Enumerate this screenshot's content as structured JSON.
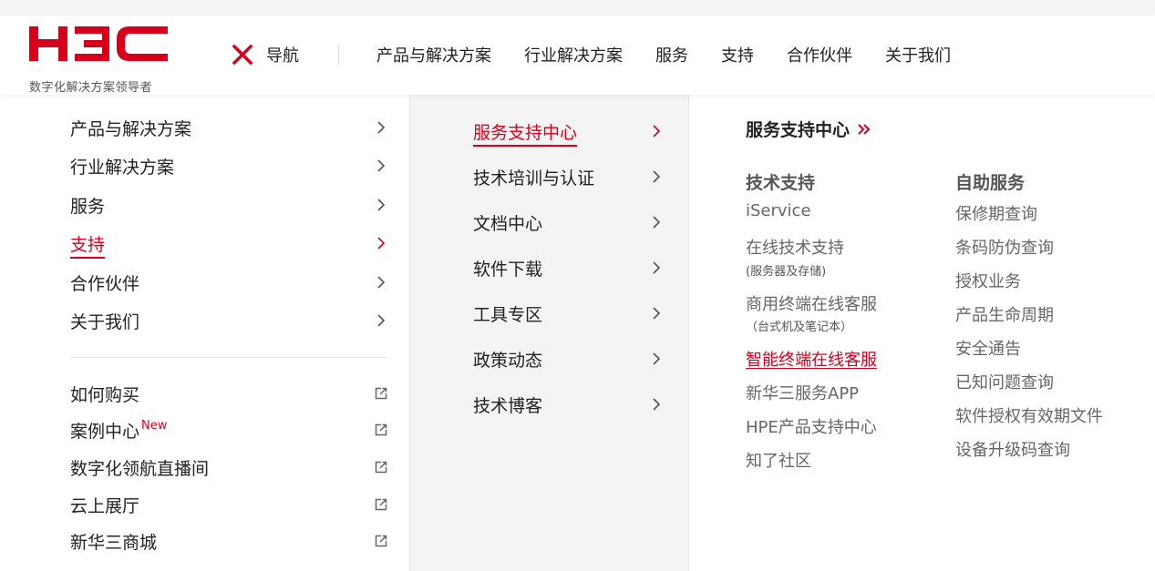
{
  "logo": {
    "wordmark": "H3C",
    "tagline": "数字化解决方案领导者",
    "brand_color": "#d6001c"
  },
  "header": {
    "nav_toggle_label": "导航",
    "close_icon": "close-x-icon",
    "nav_items": [
      "产品与解决方案",
      "行业解决方案",
      "服务",
      "支持",
      "合作伙伴",
      "关于我们"
    ]
  },
  "left_menu": {
    "items": [
      {
        "label": "产品与解决方案"
      },
      {
        "label": "行业解决方案"
      },
      {
        "label": "服务"
      },
      {
        "label": "支持",
        "active": true
      },
      {
        "label": "合作伙伴"
      },
      {
        "label": "关于我们"
      }
    ],
    "links": [
      {
        "label": "如何购买"
      },
      {
        "label": "案例中心",
        "badge": "New"
      },
      {
        "label": "数字化领航直播间"
      },
      {
        "label": "云上展厅"
      },
      {
        "label": "新华三商城"
      }
    ]
  },
  "mid_menu": {
    "items": [
      {
        "label": "服务支持中心",
        "active": true
      },
      {
        "label": "技术培训与认证"
      },
      {
        "label": "文档中心"
      },
      {
        "label": "软件下载"
      },
      {
        "label": "工具专区"
      },
      {
        "label": "政策动态"
      },
      {
        "label": "技术博客"
      }
    ]
  },
  "right_panel": {
    "title": "服务支持中心",
    "tech_support": {
      "heading": "技术支持",
      "links": {
        "iservice": "iService",
        "online": "在线技术支持",
        "online_note": "(服务器及存储)",
        "commercial": "商用终端在线客服",
        "commercial_note": "（台式机及笔记本）",
        "smart": "智能终端在线客服",
        "app": "新华三服务APP",
        "hpe": "HPE产品支持中心",
        "community": "知了社区"
      }
    },
    "self_service": {
      "heading": "自助服务",
      "links": [
        "保修期查询",
        "条码防伪查询",
        "授权业务",
        "产品生命周期",
        "安全通告",
        "已知问题查询",
        "软件授权有效期文件",
        "设备升级码查询"
      ]
    }
  }
}
